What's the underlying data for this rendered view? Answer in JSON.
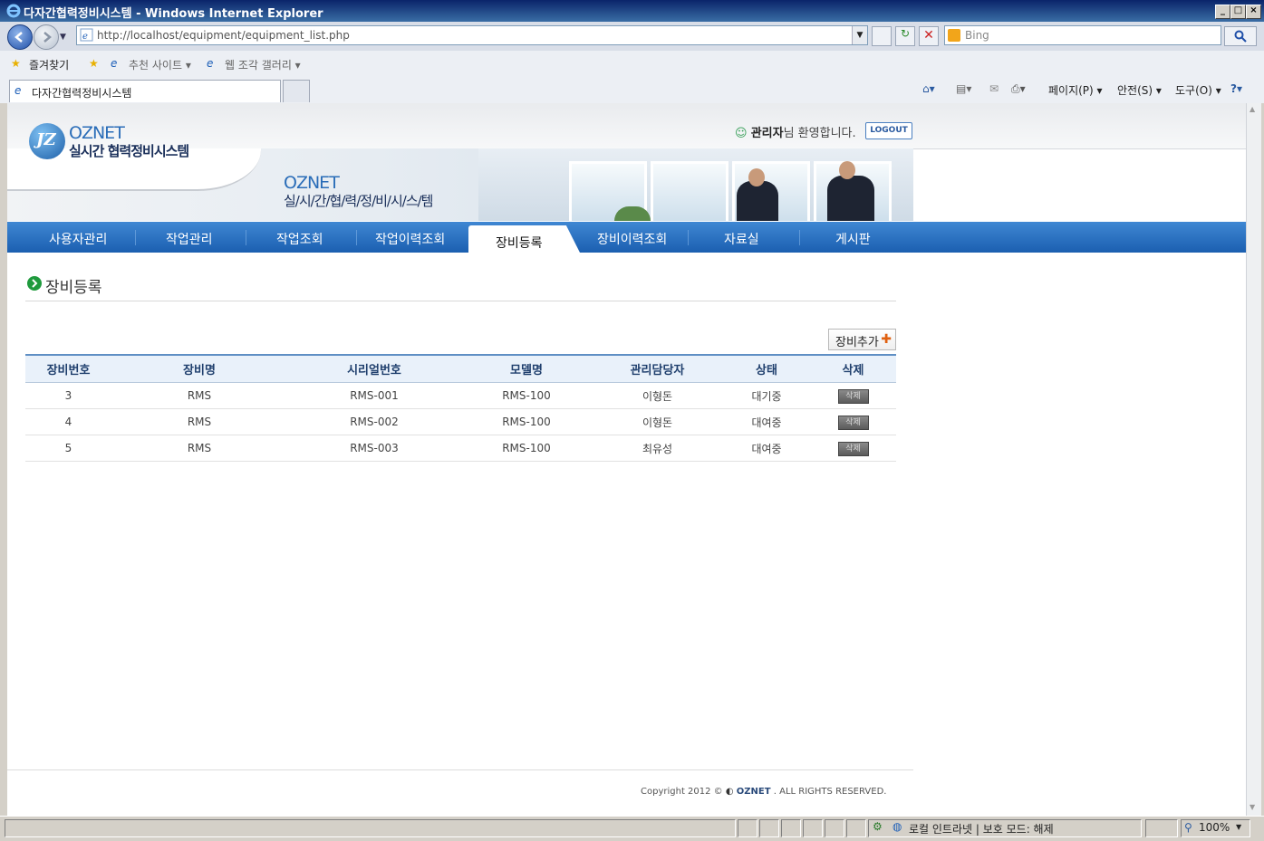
{
  "window": {
    "title": "다자간협력정비시스템 - Windows Internet Explorer"
  },
  "browser": {
    "url": "http://localhost/equipment/equipment_list.php",
    "search_placeholder": "Bing",
    "favorites": {
      "label": "즐겨찾기",
      "suggested": "추천 사이트 ▾",
      "gallery": "웹 조각 갤러리 ▾"
    },
    "tab_title": "다자간협력정비시스템",
    "commands": {
      "page": "페이지(P) ▾",
      "safety": "안전(S) ▾",
      "tools": "도구(O) ▾"
    }
  },
  "header": {
    "logo_text": "OZNET",
    "logo_sub": "실시간 협력정비시스템",
    "welcome_user": "관리자",
    "welcome_rest": "님 환영합니다.",
    "logout": "LOGOUT",
    "banner_title": "OZNET",
    "banner_sub": "실/시/간/협/력/정/비/시/스/템"
  },
  "menu": {
    "items": [
      "사용자관리",
      "작업관리",
      "작업조회",
      "작업이력조회",
      "장비등록",
      "장비이력조회",
      "자료실",
      "게시판"
    ],
    "active_index": 4
  },
  "section": {
    "title": "장비등록",
    "add_button": "장비추가"
  },
  "table": {
    "headers": [
      "장비번호",
      "장비명",
      "시리얼번호",
      "모델명",
      "관리담당자",
      "상태",
      "삭제"
    ],
    "rows": [
      [
        "3",
        "RMS",
        "RMS-001",
        "RMS-100",
        "이형돈",
        "대기중",
        "삭제"
      ],
      [
        "4",
        "RMS",
        "RMS-002",
        "RMS-100",
        "이형돈",
        "대여중",
        "삭제"
      ],
      [
        "5",
        "RMS",
        "RMS-003",
        "RMS-100",
        "최유성",
        "대여중",
        "삭제"
      ]
    ]
  },
  "footer": {
    "prefix": "Copyright 2012 ©",
    "brand": "OZNET",
    "suffix": ". ALL RIGHTS RESERVED."
  },
  "status": {
    "zone": "로컬 인트라넷 | 보호 모드: 해제",
    "zoom": "100%"
  }
}
